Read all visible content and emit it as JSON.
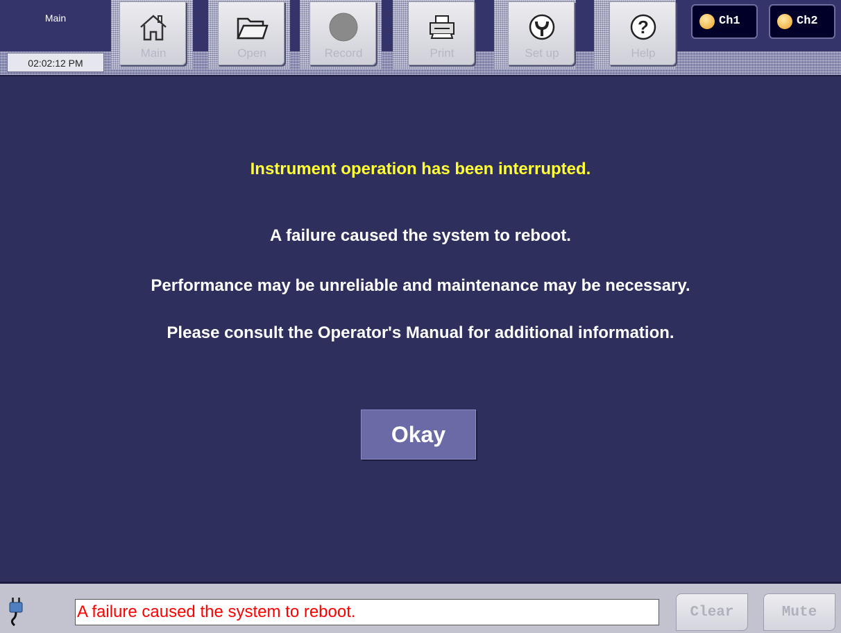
{
  "header": {
    "screen_name": "Main",
    "clock": "02:02:12 PM",
    "toolbar": [
      {
        "label": "Main",
        "icon": "home-icon"
      },
      {
        "label": "Open",
        "icon": "folder-icon"
      },
      {
        "label": "Record",
        "icon": "record-icon"
      },
      {
        "label": "Print",
        "icon": "printer-icon"
      },
      {
        "label": "Set up",
        "icon": "wrench-icon"
      },
      {
        "label": "Help",
        "icon": "help-icon"
      }
    ],
    "channels": [
      {
        "label": "Ch1",
        "icon": "indicator-light-icon"
      },
      {
        "label": "Ch2",
        "icon": "indicator-light-icon"
      }
    ]
  },
  "dialog": {
    "title": "Instrument operation has been interrupted.",
    "line1": "A failure caused the system to reboot.",
    "line2": "Performance may be unreliable and maintenance may be necessary.",
    "line3": "Please consult the Operator's Manual for additional information.",
    "okay_label": "Okay"
  },
  "footer": {
    "power_icon": "power-plug-icon",
    "status_message": "A failure caused the system to reboot.",
    "clear_label": "Clear",
    "mute_label": "Mute"
  },
  "colors": {
    "background": "#2f2f5e",
    "title_text": "#ffff33",
    "status_text": "#ff0000",
    "okay_button": "#6a6aa6"
  }
}
